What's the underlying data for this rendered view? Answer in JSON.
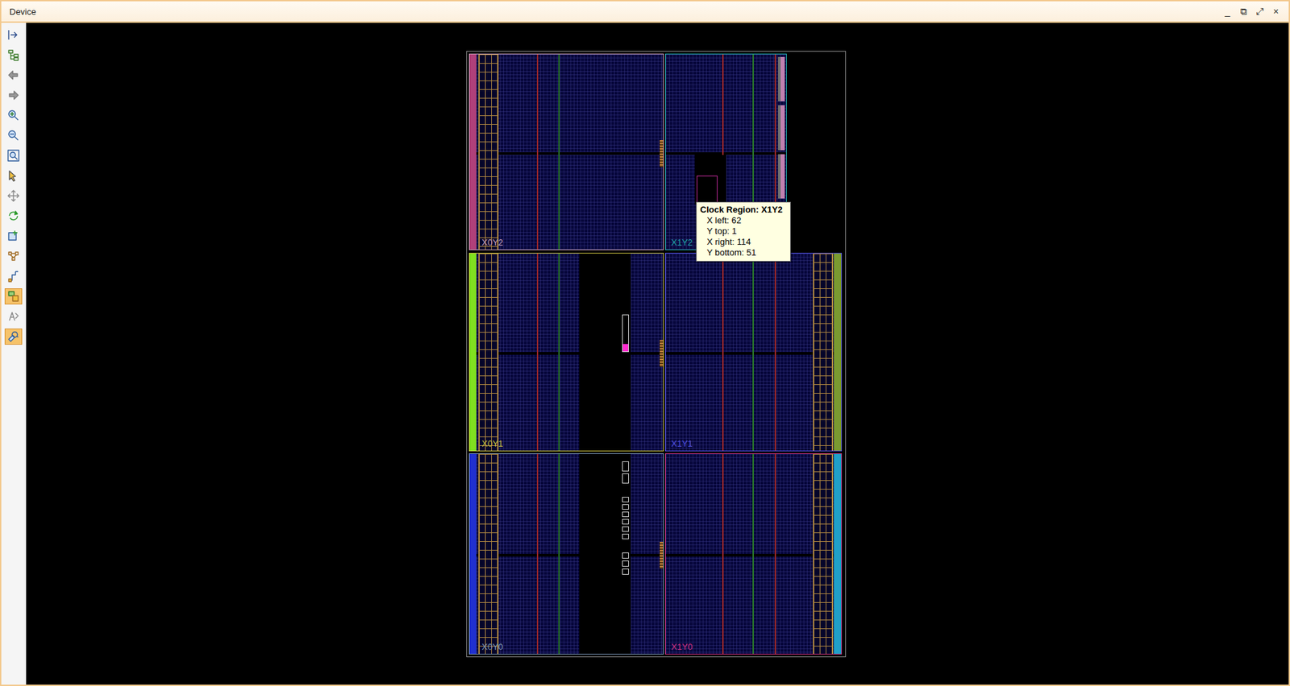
{
  "window": {
    "title": "Device",
    "controls": [
      "_",
      "⧉",
      "⤢",
      "×"
    ]
  },
  "toolbar": [
    {
      "selected": false
    },
    {
      "selected": false
    },
    {
      "selected": false
    },
    {
      "selected": false
    },
    {
      "selected": false
    },
    {
      "selected": false
    },
    {
      "selected": false
    },
    {
      "selected": false
    },
    {
      "selected": false
    },
    {
      "selected": false
    },
    {
      "selected": false
    },
    {
      "selected": false
    },
    {
      "selected": false
    },
    {
      "selected": true
    },
    {
      "selected": false
    },
    {
      "selected": true
    }
  ],
  "regions": [
    {
      "label": "X0Y2",
      "color": "#c8a0b8"
    },
    {
      "label": "X1Y2",
      "color": "#20a8a8"
    },
    {
      "label": "X0Y1",
      "color": "#c8c040"
    },
    {
      "label": "X1Y1",
      "color": "#5050e0"
    },
    {
      "label": "X0Y0",
      "color": "#7c98b8"
    },
    {
      "label": "X1Y0",
      "color": "#d03080"
    }
  ],
  "tooltip": {
    "title": "Clock Region: X1Y2",
    "lines": [
      "X left: 62",
      "Y top: 1",
      "X right: 114",
      "Y bottom: 51"
    ]
  }
}
